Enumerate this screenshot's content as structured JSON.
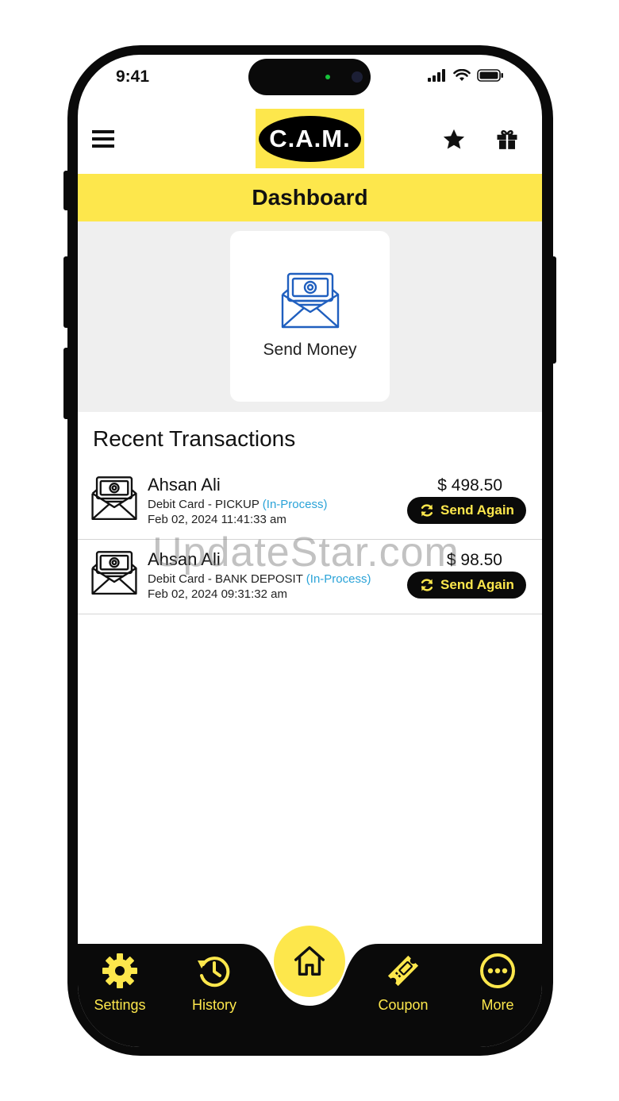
{
  "status_bar": {
    "time": "9:41"
  },
  "header": {
    "logo_text": "C.A.M."
  },
  "page_title": "Dashboard",
  "quick_actions": [
    {
      "label": "Send Money",
      "icon": "money-envelope-icon"
    }
  ],
  "recent_title": "Recent Transactions",
  "transactions": [
    {
      "name": "Ahsan Ali",
      "method": "Debit Card - PICKUP",
      "status": "(In-Process)",
      "date": "Feb 02, 2024 11:41:33 am",
      "amount": "$ 498.50",
      "action_label": "Send Again"
    },
    {
      "name": "Ahsan Ali",
      "method": "Debit Card - BANK DEPOSIT",
      "status": "(In-Process)",
      "date": "Feb 02, 2024 09:31:32 am",
      "amount": "$ 98.50",
      "action_label": "Send Again"
    }
  ],
  "watermark": "UpdateStar.com",
  "nav": {
    "settings": "Settings",
    "history": "History",
    "coupon": "Coupon",
    "more": "More"
  },
  "colors": {
    "accent": "#fde74c",
    "dark": "#0a0a0a",
    "status_blue": "#2aa3d8",
    "icon_blue": "#1f5fbf"
  }
}
